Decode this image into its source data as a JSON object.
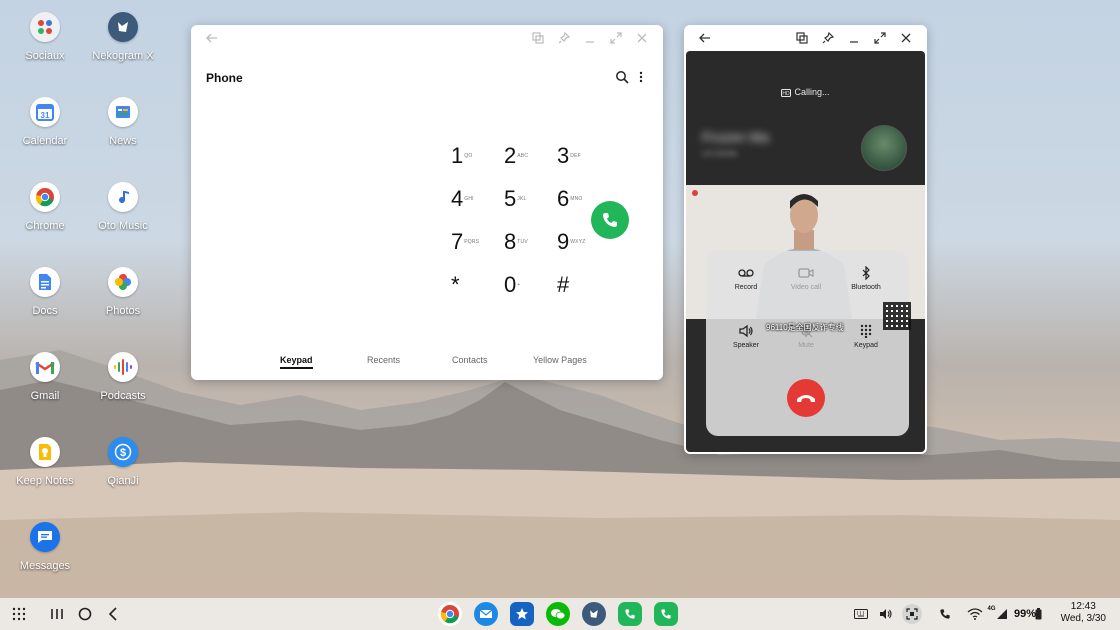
{
  "desktop": {
    "icons": [
      {
        "label": "Sociaux",
        "icon": "folder-icon"
      },
      {
        "label": "Nekogram X",
        "icon": "nekogram-icon"
      },
      {
        "label": "Calendar",
        "icon": "calendar-icon",
        "badge": "31"
      },
      {
        "label": "News",
        "icon": "news-icon"
      },
      {
        "label": "Chrome",
        "icon": "chrome-icon"
      },
      {
        "label": "Oto Music",
        "icon": "music-icon"
      },
      {
        "label": "Docs",
        "icon": "docs-icon"
      },
      {
        "label": "Photos",
        "icon": "photos-icon"
      },
      {
        "label": "Gmail",
        "icon": "gmail-icon"
      },
      {
        "label": "Podcasts",
        "icon": "podcasts-icon"
      },
      {
        "label": "Keep Notes",
        "icon": "keep-icon"
      },
      {
        "label": "QianJi",
        "icon": "qianji-icon"
      },
      {
        "label": "Messages",
        "icon": "messages-icon"
      }
    ]
  },
  "phone_window": {
    "title": "Phone",
    "keypad": [
      {
        "digit": "1",
        "letters": "QO"
      },
      {
        "digit": "2",
        "letters": "ABC"
      },
      {
        "digit": "3",
        "letters": "DEF"
      },
      {
        "digit": "4",
        "letters": "GHI"
      },
      {
        "digit": "5",
        "letters": "JKL"
      },
      {
        "digit": "6",
        "letters": "MNO"
      },
      {
        "digit": "7",
        "letters": "PQRS"
      },
      {
        "digit": "8",
        "letters": "TUV"
      },
      {
        "digit": "9",
        "letters": "WXYZ"
      },
      {
        "digit": "*",
        "letters": ""
      },
      {
        "digit": "0",
        "letters": "+"
      },
      {
        "digit": "#",
        "letters": ""
      }
    ],
    "tabs": [
      "Keypad",
      "Recents",
      "Contacts",
      "Yellow Pages"
    ],
    "active_tab": "Keypad"
  },
  "call_window": {
    "status": "Calling...",
    "caller_name": "Frozen Ma",
    "caller_sub": "LA Center",
    "video_caption": "96110是全国反诈专线",
    "controls_top": [
      "Record",
      "Video call",
      "Bluetooth"
    ],
    "controls_bottom": [
      "Speaker",
      "Mute",
      "Keypad"
    ]
  },
  "taskbar": {
    "battery": "99%",
    "network": "4G",
    "time": "12:43",
    "date": "Wed, 3/30"
  },
  "colors": {
    "call_green": "#21b65a",
    "end_red": "#e53935"
  }
}
